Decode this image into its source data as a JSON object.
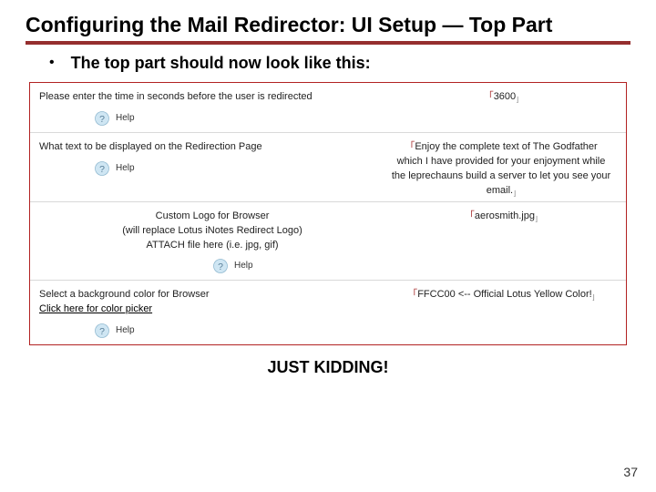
{
  "title": "Configuring the Mail Redirector: UI Setup — Top Part",
  "subhead": "The top part should now look like this:",
  "rows": [
    {
      "label_html": "Please enter the time in seconds before the user is redirected",
      "centered": false,
      "link": null,
      "value": "3600",
      "help": "Help"
    },
    {
      "label_html": "What text to be displayed on the Redirection Page",
      "centered": false,
      "link": null,
      "value": "Enjoy the complete text of The Godfather which I have provided for your enjoyment while the leprechauns build a server to let you see your email.",
      "help": "Help"
    },
    {
      "label_html": "Custom Logo for Browser\n(will replace Lotus iNotes Redirect Logo)\nATTACH file here (i.e. jpg, gif)",
      "centered": true,
      "link": null,
      "value": "aerosmith.jpg",
      "help": "Help"
    },
    {
      "label_html": "Select a background color for Browser",
      "centered": false,
      "link": "Click here for color picker",
      "value": "FFCC00 <-- Official Lotus Yellow Color!",
      "help": "Help"
    }
  ],
  "kidding": "JUST KIDDING!",
  "page_number": "37"
}
